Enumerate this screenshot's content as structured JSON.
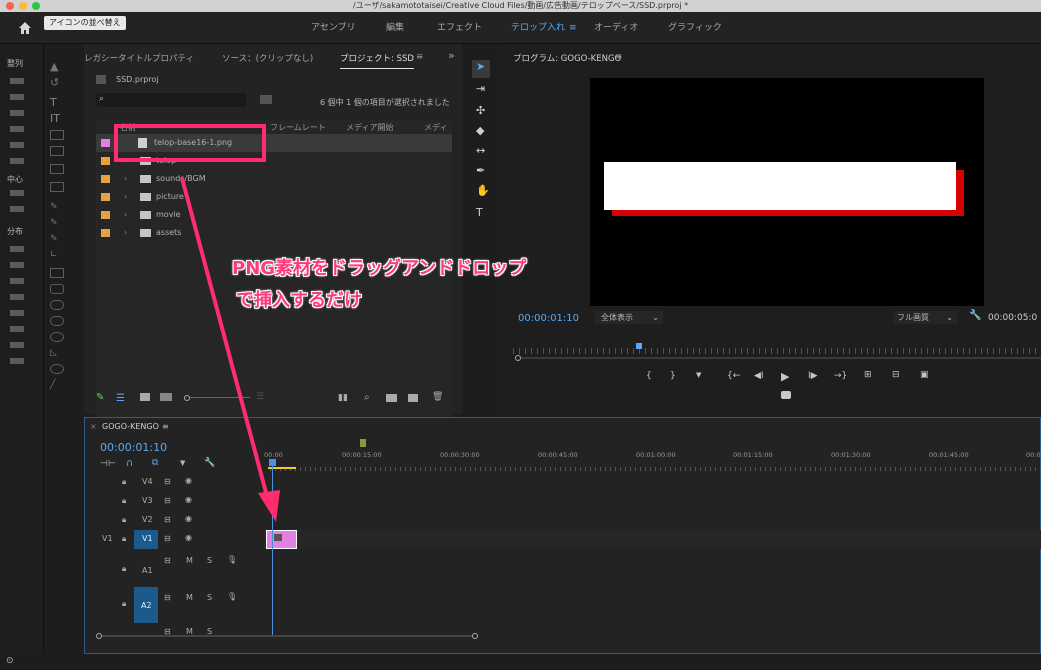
{
  "window": {
    "title": "/ユーザ/sakamototaisei/Creative Cloud Files/動画/広告動画/テロップベース/SSD.prproj *"
  },
  "topbar": {
    "home_icon": "home-icon",
    "tooltip": "アイコンの並べ替え",
    "workspaces": [
      "アセンブリ",
      "編集",
      "エフェクト",
      "テロップ入れ",
      "オーディオ",
      "グラフィック"
    ],
    "active_workspace": "テロップ入れ",
    "menu_icon": "≡"
  },
  "left_strip": {
    "labels": [
      "整列",
      "中心",
      "分布"
    ]
  },
  "project_panel": {
    "tabs": [
      "レガシータイトルプロパティ",
      "ソース：(クリップなし)",
      "プロジェクト: SSD"
    ],
    "tab_menu": "≡",
    "overflow": "»",
    "file": "SSD.prproj",
    "search_placeholder": "",
    "status": "6 個中 1 個の項目が選択されました",
    "columns": [
      "名前",
      "フレームレート",
      "メディア開始",
      "メディア"
    ],
    "items": [
      {
        "name": "telop-base16-1.png",
        "color": "#e37ee3",
        "type": "image",
        "selected": true
      },
      {
        "name": "telop",
        "color": "#e9a23b",
        "type": "folder"
      },
      {
        "name": "sounds/BGM",
        "color": "#e9a23b",
        "type": "folder"
      },
      {
        "name": "picture",
        "color": "#e9a23b",
        "type": "folder"
      },
      {
        "name": "movie",
        "color": "#e9a23b",
        "type": "folder"
      },
      {
        "name": "assets",
        "color": "#e9a23b",
        "type": "folder"
      }
    ]
  },
  "program_panel": {
    "title": "プログラム: GOGO-KENGO",
    "menu": "≡",
    "timecode": "00:00:01:10",
    "zoom": "全体表示",
    "quality": "フル画質",
    "duration": "00:00:05:0"
  },
  "transport": [
    "{",
    "}",
    "▼",
    "{←",
    "◀I",
    "▶",
    "I▶",
    "→}",
    "⊞",
    "⊟",
    "▣"
  ],
  "timeline": {
    "sequence": "GOGO-KENGO",
    "menu": "≡",
    "timecode": "00:00:01:10",
    "ruler": [
      "00:00",
      "00:00:15:00",
      "00:00:30:00",
      "00:00:45:00",
      "00:01:00:00",
      "00:01:15:00",
      "00:01:30:00",
      "00:01:45:00",
      "00:0"
    ],
    "video_tracks": [
      "V4",
      "V3",
      "V2",
      "V1"
    ],
    "source_patch": "V1",
    "audio_tracks": [
      "A1",
      "A2"
    ],
    "audio_buttons": [
      "M",
      "S"
    ]
  },
  "annotation": {
    "line1": "PNG素材をドラッグアンドドロップ",
    "line2": "で挿入するだけ",
    "color": "#ff2d6e"
  }
}
